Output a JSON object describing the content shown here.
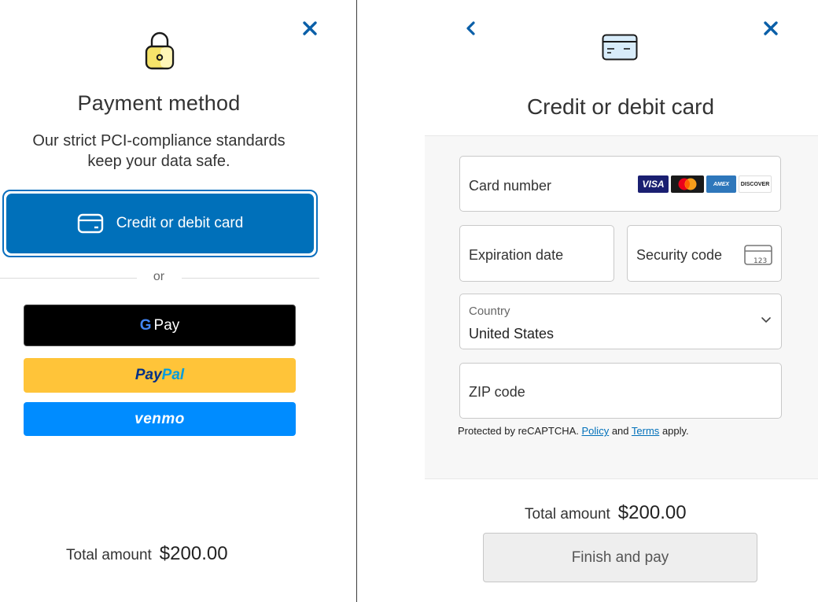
{
  "left": {
    "close_icon": "close-icon",
    "lock_icon": "lock-icon",
    "title": "Payment method",
    "subtitle_line1": "Our strict PCI-compliance standards",
    "subtitle_line2": "keep your data safe.",
    "card_button_label": "Credit or debit card",
    "or_text": "or",
    "gpay_g": "G",
    "gpay_label": "Pay",
    "paypal_part1": "Pay",
    "paypal_part2": "Pal",
    "venmo_label": "venmo",
    "total_label": "Total amount",
    "total_value": "$200.00"
  },
  "right": {
    "back_icon": "chevron-left-icon",
    "close_icon": "close-icon",
    "card_icon": "credit-card-icon",
    "title": "Credit or debit card",
    "card_number_label": "Card number",
    "card_brands": [
      "VISA",
      "Mastercard",
      "AMEX",
      "DISCOVER"
    ],
    "expiration_label": "Expiration date",
    "security_label": "Security code",
    "cvv_hint": "123",
    "country_label": "Country",
    "country_value": "United States",
    "zip_label": "ZIP code",
    "recaptcha_prefix": "Protected by reCAPTCHA.",
    "recaptcha_policy": "Policy",
    "recaptcha_and": "and",
    "recaptcha_terms": "Terms",
    "recaptcha_suffix": "apply.",
    "total_label": "Total amount",
    "total_value": "$200.00",
    "finish_label": "Finish and pay"
  },
  "colors": {
    "primary_blue": "#0070ba",
    "paypal_yellow": "#ffc439",
    "venmo_blue": "#008cff",
    "gpay_black": "#000000"
  }
}
